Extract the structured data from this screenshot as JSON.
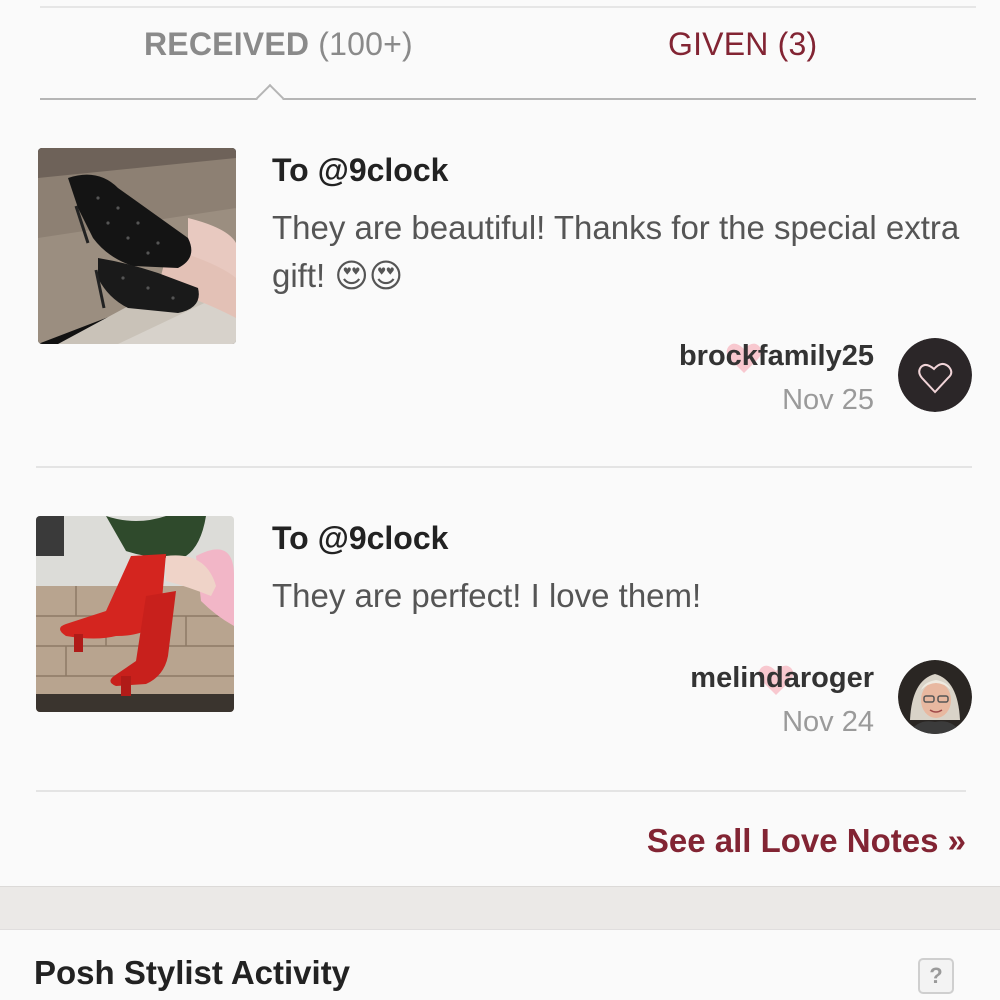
{
  "tabs": {
    "received_label": "RECEIVED",
    "received_count": "(100+)",
    "given_label": "GIVEN (3)"
  },
  "notes": [
    {
      "to": "To @9clock",
      "text": "They are beautiful! Thanks for the special extra gift! 😍😍",
      "username": "brockfamily25",
      "date": "Nov 25",
      "thumb_icon": "black-sparkle-boots-photo",
      "avatar_icon": "heart-outline-avatar"
    },
    {
      "to": "To @9clock",
      "text": "They are perfect! I love them!",
      "username": "melindaroger",
      "date": "Nov 24",
      "thumb_icon": "red-knee-boots-photo",
      "avatar_icon": "user-photo-avatar"
    }
  ],
  "see_all": "See all Love Notes »",
  "stylist": {
    "title": "Posh Stylist Activity",
    "help": "?"
  },
  "colors": {
    "accent": "#822433",
    "heart": "#f8c8cf",
    "muted": "#9a9a9a"
  }
}
